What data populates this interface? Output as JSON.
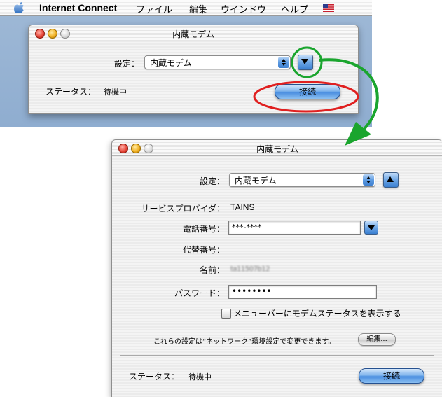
{
  "menubar": {
    "app_name": "Internet Connect",
    "items": [
      "ファイル",
      "編集",
      "ウインドウ",
      "ヘルプ"
    ]
  },
  "window_small": {
    "title": "内蔵モデム",
    "config_label": "設定：",
    "config_value": "内蔵モデム",
    "status_label": "ステータス：",
    "status_value": "待機中",
    "connect_label": "接続"
  },
  "window_large": {
    "title": "内蔵モデム",
    "config_label": "設定：",
    "config_value": "内蔵モデム",
    "provider_label": "サービスプロバイダ：",
    "provider_value": "TAINS",
    "phone_label": "電話番号：",
    "phone_value": "***-****",
    "alt_phone_label": "代替番号：",
    "name_label": "名前：",
    "name_value": "ta11507b12",
    "password_label": "パスワード：",
    "password_value": "••••••••",
    "show_status_label": "メニューバーにモデムステータスを表示する",
    "network_note": "これらの設定は“ネットワーク”環境設定で変更できます。",
    "edit_label": "編集...",
    "status_label": "ステータス：",
    "status_value": "待機中",
    "connect_label": "接続"
  },
  "annotations": {
    "green_circle_color": "#1aa52e",
    "red_ellipse_color": "#e02020",
    "arrow_color": "#1aa52e"
  }
}
